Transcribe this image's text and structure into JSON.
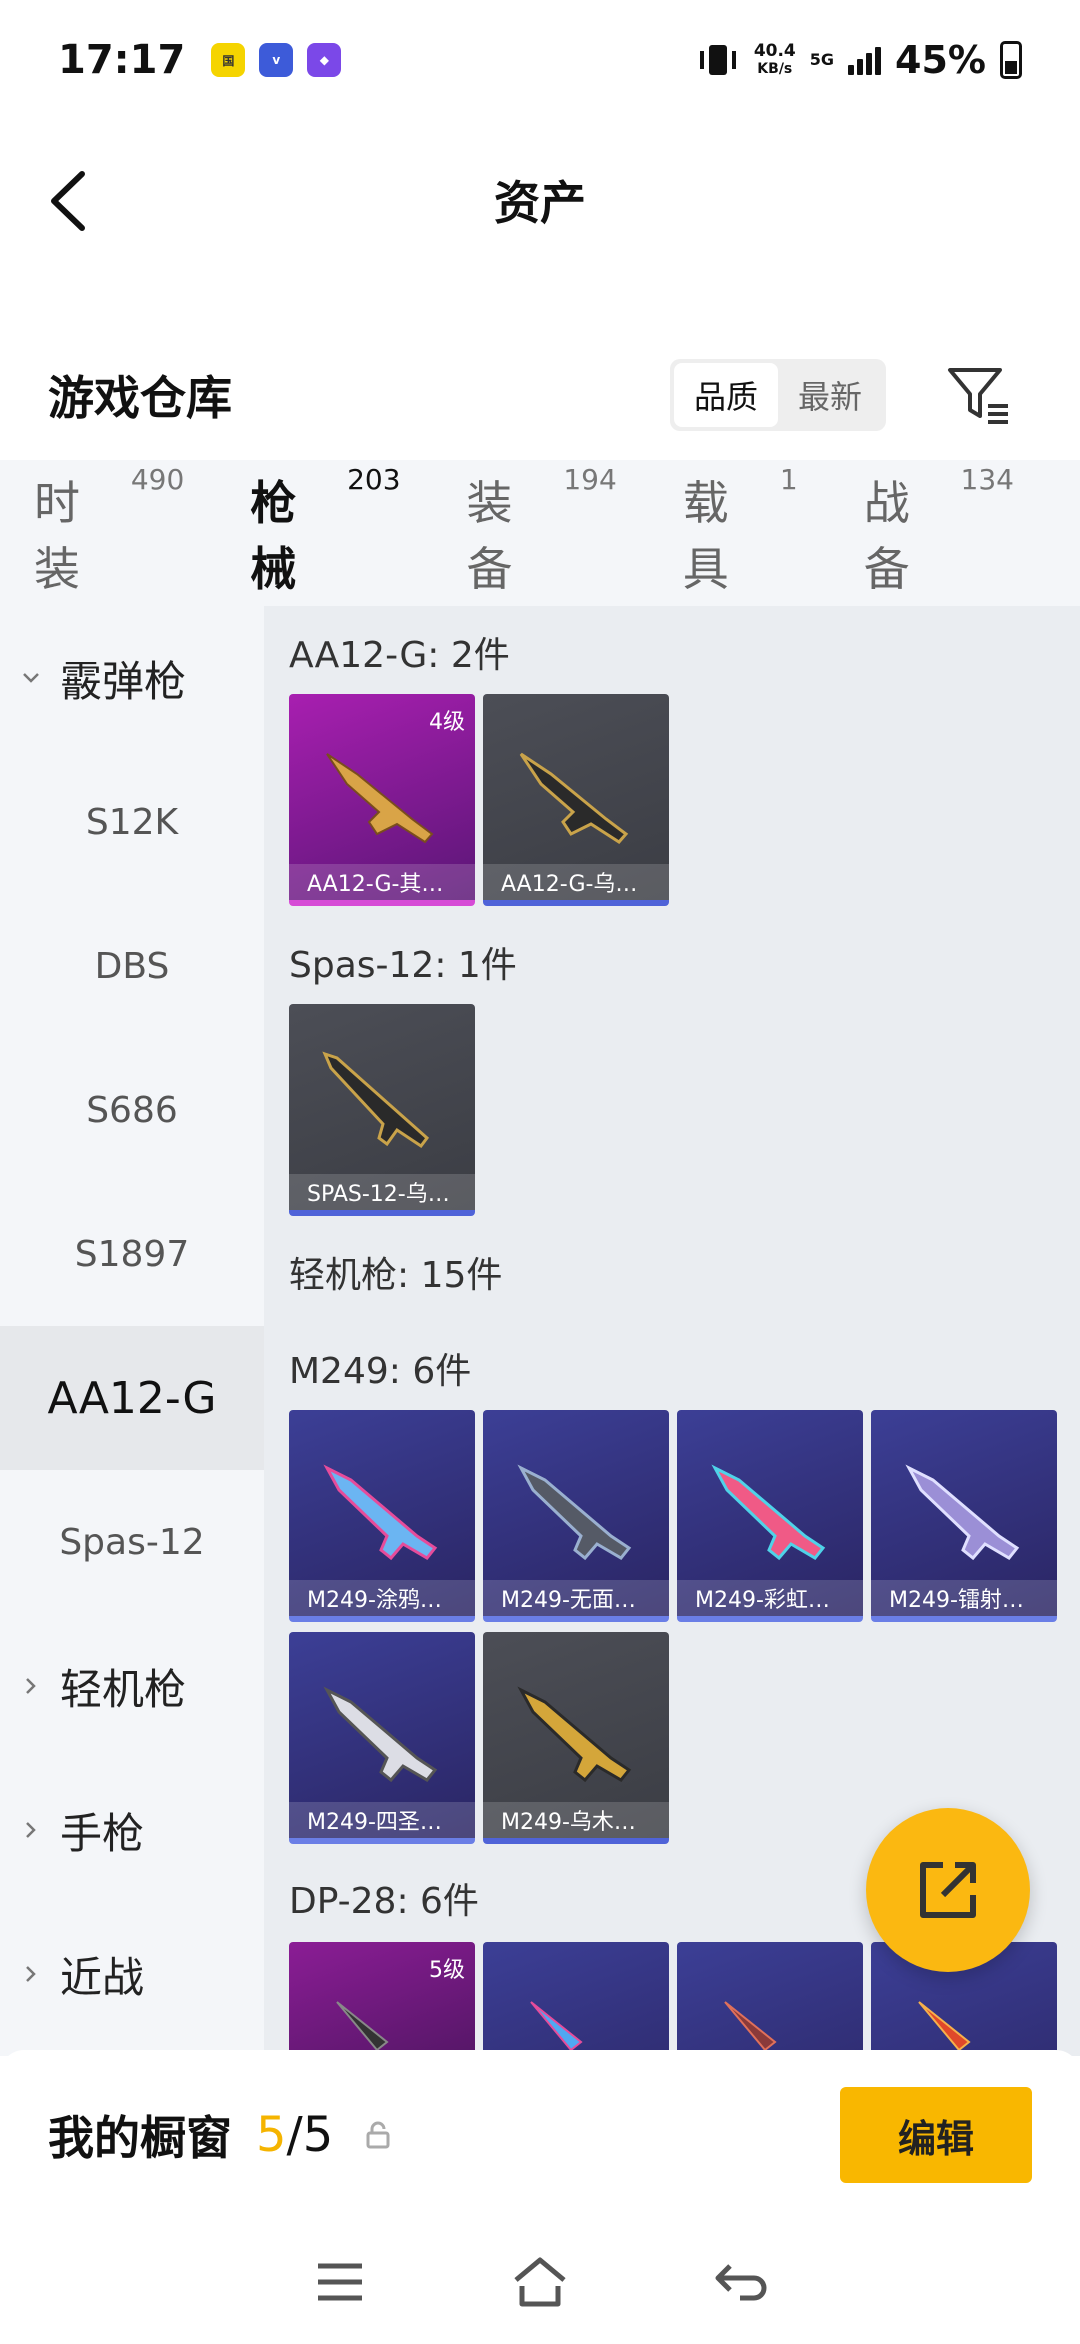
{
  "status": {
    "time": "17:17",
    "speed_value": "40.4",
    "speed_unit": "KB/s",
    "net": "5G",
    "battery": "45%"
  },
  "header": {
    "title": "资产"
  },
  "warehouse": {
    "title": "游戏仓库",
    "sort_options": [
      "品质",
      "最新"
    ],
    "sort_active": "品质"
  },
  "tabs": [
    {
      "label": "时装",
      "count": "490"
    },
    {
      "label": "枪械",
      "count": "203"
    },
    {
      "label": "装备",
      "count": "194"
    },
    {
      "label": "载具",
      "count": "1"
    },
    {
      "label": "战备",
      "count": "134"
    }
  ],
  "active_tab": "枪械",
  "sidebar": {
    "group_shotgun": "霰弹枪",
    "items": [
      "S12K",
      "DBS",
      "S686",
      "S1897",
      "AA12-G",
      "Spas-12"
    ],
    "active": "AA12-G",
    "group_lmg": "轻机枪",
    "group_pistol": "手枪",
    "group_melee": "近战"
  },
  "sections": {
    "aa12": {
      "title": "AA12-G: 2件"
    },
    "spas": {
      "title": "Spas-12: 1件"
    },
    "lmg": {
      "title": "轻机枪: 15件"
    },
    "m249": {
      "title": "M249: 6件"
    },
    "dp28": {
      "title": "DP-28: 6件"
    }
  },
  "cards": {
    "aa12_1": {
      "label": "AA12-G-其…",
      "level": "4级"
    },
    "aa12_2": {
      "label": "AA12-G-乌…"
    },
    "spas_1": {
      "label": "SPAS-12-乌…"
    },
    "m249_1": {
      "label": "M249-涂鸦…"
    },
    "m249_2": {
      "label": "M249-无面…"
    },
    "m249_3": {
      "label": "M249-彩虹…"
    },
    "m249_4": {
      "label": "M249-镭射…"
    },
    "m249_5": {
      "label": "M249-四圣…"
    },
    "m249_6": {
      "label": "M249-乌木…"
    },
    "dp28_1": {
      "level": "5级"
    }
  },
  "window": {
    "title": "我的橱窗",
    "current": "5",
    "total": "/5",
    "edit": "编辑"
  },
  "colors": {
    "accent": "#f5b400",
    "legendary": "#d64bd6",
    "rare": "#4f63d8"
  }
}
